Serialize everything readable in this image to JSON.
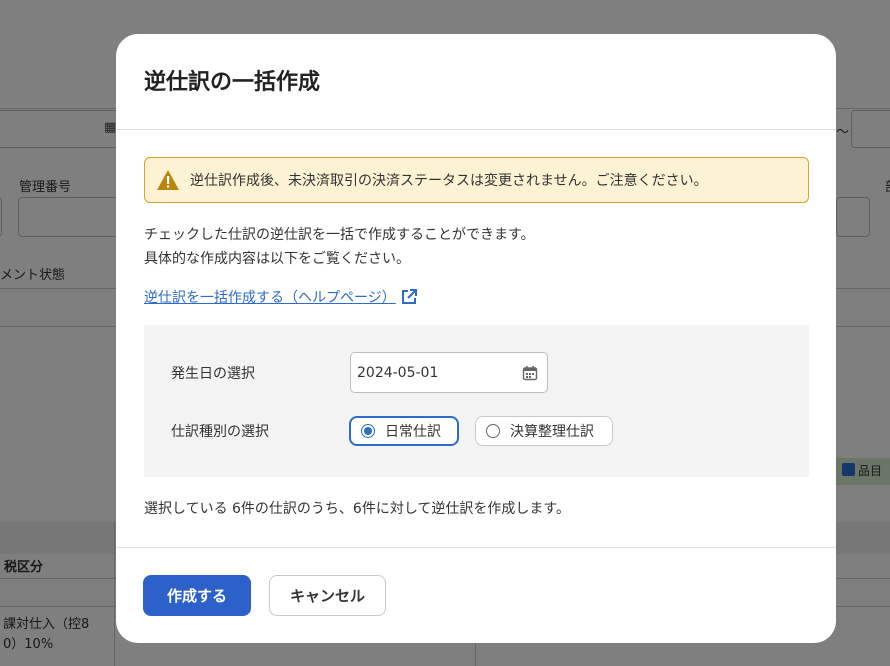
{
  "background": {
    "label_management_no": "管理番号",
    "label_document_status": "メント状態",
    "label_tax_category": "税区分",
    "cell_tax_value": "課対仕入（控80）10%",
    "cell_tax_line1": "課対仕入（控8",
    "cell_tax_line2": "0）10%",
    "tilde": "～",
    "right_edge_label": "品目",
    "right_edge_top": "部"
  },
  "modal": {
    "title": "逆仕訳の一括作成",
    "warning": "逆仕訳作成後、未決済取引の決済ステータスは変更されません。ご注意ください。",
    "description_line1": "チェックした仕訳の逆仕訳を一括で作成することができます。",
    "description_line2": "具体的な作成内容は以下をご覧ください。",
    "help_link": "逆仕訳を一括作成する（ヘルプページ）",
    "date_label": "発生日の選択",
    "date_value": "2024-05-01",
    "type_label": "仕訳種別の選択",
    "type_options": [
      {
        "label": "日常仕訳",
        "selected": true
      },
      {
        "label": "決算整理仕訳",
        "selected": false
      }
    ],
    "summary": "選択している 6件の仕訳のうち、6件に対して逆仕訳を作成します。",
    "submit_label": "作成する",
    "cancel_label": "キャンセル"
  },
  "colors": {
    "primary": "#2b61c9",
    "link": "#2d6cc9",
    "warning_bg": "#fdf2d3",
    "warning_border": "#d9a520",
    "overlay": "rgba(0,0,0,0.5)"
  }
}
